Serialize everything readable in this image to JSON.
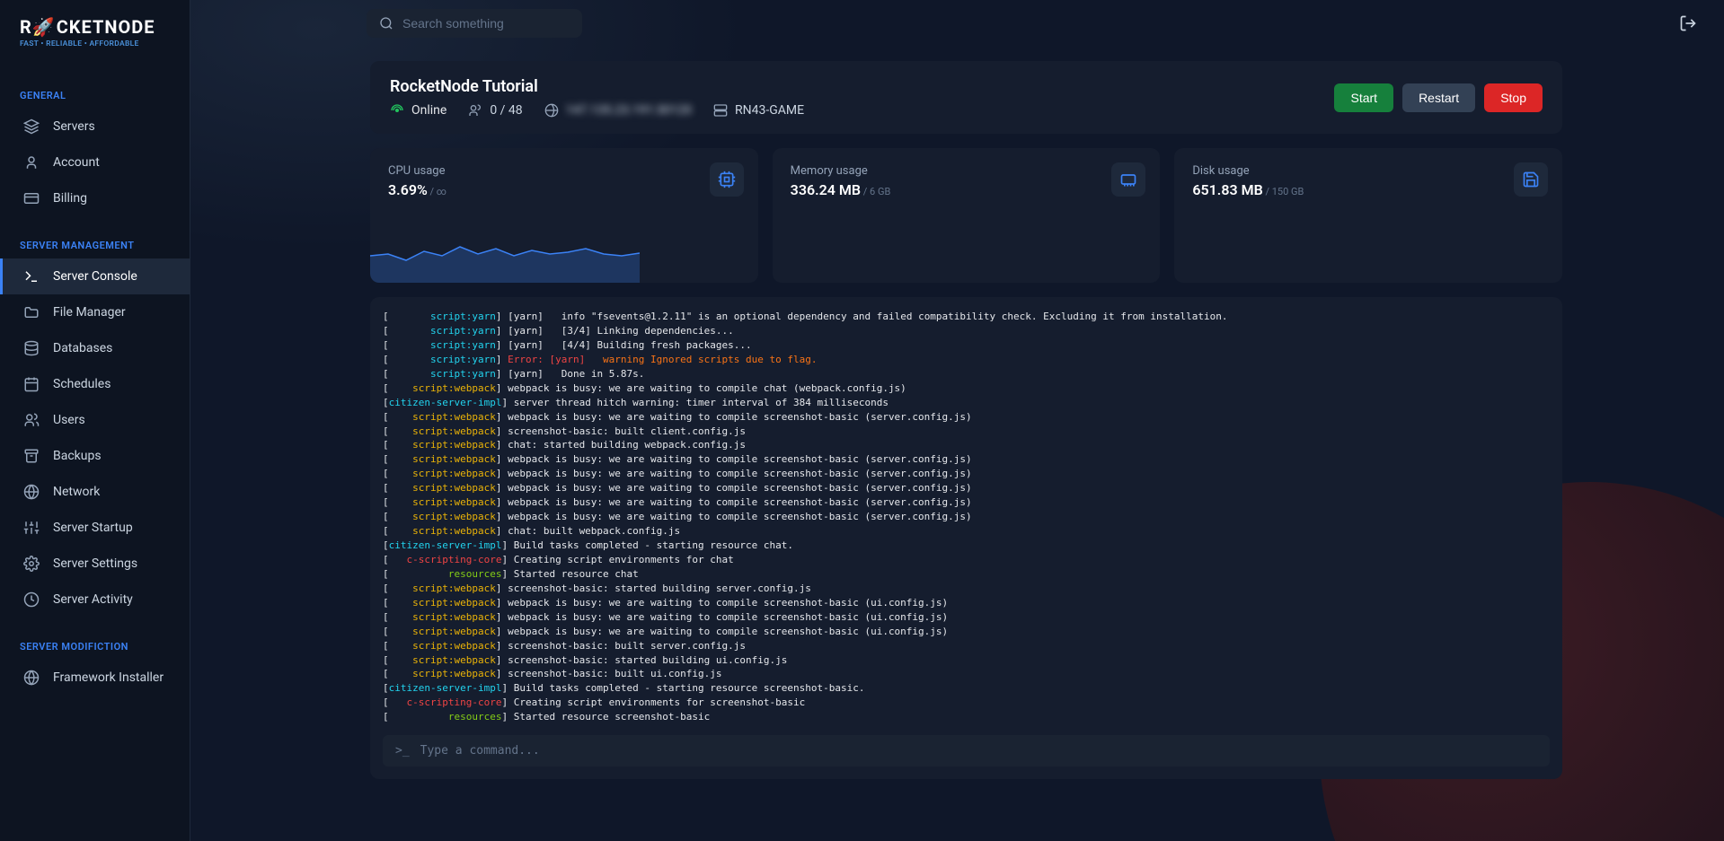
{
  "brand": {
    "name_pre": "R",
    "name_post": "CKETNODE",
    "tagline": "FAST • RELIABLE • AFFORDABLE"
  },
  "search": {
    "placeholder": "Search something"
  },
  "nav": {
    "general": {
      "heading": "GENERAL",
      "items": [
        {
          "label": "Servers"
        },
        {
          "label": "Account"
        },
        {
          "label": "Billing"
        }
      ]
    },
    "mgmt": {
      "heading": "SERVER MANAGEMENT",
      "items": [
        {
          "label": "Server Console"
        },
        {
          "label": "File Manager"
        },
        {
          "label": "Databases"
        },
        {
          "label": "Schedules"
        },
        {
          "label": "Users"
        },
        {
          "label": "Backups"
        },
        {
          "label": "Network"
        },
        {
          "label": "Server Startup"
        },
        {
          "label": "Server Settings"
        },
        {
          "label": "Server Activity"
        }
      ]
    },
    "mod": {
      "heading": "SERVER MODIFICTION",
      "items": [
        {
          "label": "Framework Installer"
        }
      ]
    }
  },
  "server": {
    "title": "RocketNode Tutorial",
    "status": "Online",
    "players": "0 / 48",
    "ip": "147.135.23.191:30120",
    "node": "RN43-GAME",
    "actions": {
      "start": "Start",
      "restart": "Restart",
      "stop": "Stop"
    }
  },
  "stats": {
    "cpu": {
      "label": "CPU usage",
      "value": "3.69%",
      "sub": " / ∞"
    },
    "mem": {
      "label": "Memory usage",
      "value": "336.24 MB",
      "sub": " / 6 GB"
    },
    "disk": {
      "label": "Disk usage",
      "value": "651.83 MB",
      "sub": " / 150 GB"
    }
  },
  "console": {
    "lines": [
      {
        "tag": "       script:yarn",
        "tagColor": "tag",
        "label": "[yarn]",
        "text": "   info \"fsevents@1.2.11\" is an optional dependency and failed compatibility check. Excluding it from installation."
      },
      {
        "tag": "       script:yarn",
        "tagColor": "tag",
        "label": "[yarn]",
        "text": "   [3/4] Linking dependencies..."
      },
      {
        "tag": "       script:yarn",
        "tagColor": "tag",
        "label": "[yarn]",
        "text": "   [4/4] Building fresh packages..."
      },
      {
        "tag": "       script:yarn",
        "tagColor": "tag",
        "label": "Error: [yarn]",
        "labelColor": "tag-red",
        "text": "   warning Ignored scripts due to flag.",
        "textColor": "tag-orange"
      },
      {
        "tag": "       script:yarn",
        "tagColor": "tag",
        "label": "[yarn]",
        "text": "   Done in 5.87s."
      },
      {
        "tag": "    script:webpack",
        "tagColor": "tag-yellow",
        "text": "webpack is busy: we are waiting to compile chat (webpack.config.js)"
      },
      {
        "tag": "citizen-server-impl",
        "tagColor": "tag",
        "text": "server thread hitch warning: timer interval of 384 milliseconds"
      },
      {
        "tag": "    script:webpack",
        "tagColor": "tag-yellow",
        "text": "webpack is busy: we are waiting to compile screenshot-basic (server.config.js)"
      },
      {
        "tag": "    script:webpack",
        "tagColor": "tag-yellow",
        "text": "screenshot-basic: built client.config.js"
      },
      {
        "tag": "    script:webpack",
        "tagColor": "tag-yellow",
        "text": "chat: started building webpack.config.js"
      },
      {
        "tag": "    script:webpack",
        "tagColor": "tag-yellow",
        "text": "webpack is busy: we are waiting to compile screenshot-basic (server.config.js)"
      },
      {
        "tag": "    script:webpack",
        "tagColor": "tag-yellow",
        "text": "webpack is busy: we are waiting to compile screenshot-basic (server.config.js)"
      },
      {
        "tag": "    script:webpack",
        "tagColor": "tag-yellow",
        "text": "webpack is busy: we are waiting to compile screenshot-basic (server.config.js)"
      },
      {
        "tag": "    script:webpack",
        "tagColor": "tag-yellow",
        "text": "webpack is busy: we are waiting to compile screenshot-basic (server.config.js)"
      },
      {
        "tag": "    script:webpack",
        "tagColor": "tag-yellow",
        "text": "webpack is busy: we are waiting to compile screenshot-basic (server.config.js)"
      },
      {
        "tag": "    script:webpack",
        "tagColor": "tag-yellow",
        "text": "chat: built webpack.config.js"
      },
      {
        "tag": "citizen-server-impl",
        "tagColor": "tag",
        "text": "Build tasks completed - starting resource chat."
      },
      {
        "tag": "   c-scripting-core",
        "tagColor": "tag-red",
        "text": "Creating script environments for chat"
      },
      {
        "tag": "          resources",
        "tagColor": "tag-lime",
        "text": "Started resource chat"
      },
      {
        "tag": "    script:webpack",
        "tagColor": "tag-yellow",
        "text": "screenshot-basic: started building server.config.js"
      },
      {
        "tag": "    script:webpack",
        "tagColor": "tag-yellow",
        "text": "webpack is busy: we are waiting to compile screenshot-basic (ui.config.js)"
      },
      {
        "tag": "    script:webpack",
        "tagColor": "tag-yellow",
        "text": "webpack is busy: we are waiting to compile screenshot-basic (ui.config.js)"
      },
      {
        "tag": "    script:webpack",
        "tagColor": "tag-yellow",
        "text": "webpack is busy: we are waiting to compile screenshot-basic (ui.config.js)"
      },
      {
        "tag": "    script:webpack",
        "tagColor": "tag-yellow",
        "text": "screenshot-basic: built server.config.js"
      },
      {
        "tag": "    script:webpack",
        "tagColor": "tag-yellow",
        "text": "screenshot-basic: started building ui.config.js"
      },
      {
        "tag": "    script:webpack",
        "tagColor": "tag-yellow",
        "text": "screenshot-basic: built ui.config.js"
      },
      {
        "tag": "citizen-server-impl",
        "tagColor": "tag",
        "text": "Build tasks completed - starting resource screenshot-basic."
      },
      {
        "tag": "   c-scripting-core",
        "tagColor": "tag-red",
        "text": "Creating script environments for screenshot-basic"
      },
      {
        "tag": "          resources",
        "tagColor": "tag-lime",
        "text": "Started resource screenshot-basic"
      }
    ],
    "prompt": ">_",
    "placeholder": "Type a command..."
  }
}
